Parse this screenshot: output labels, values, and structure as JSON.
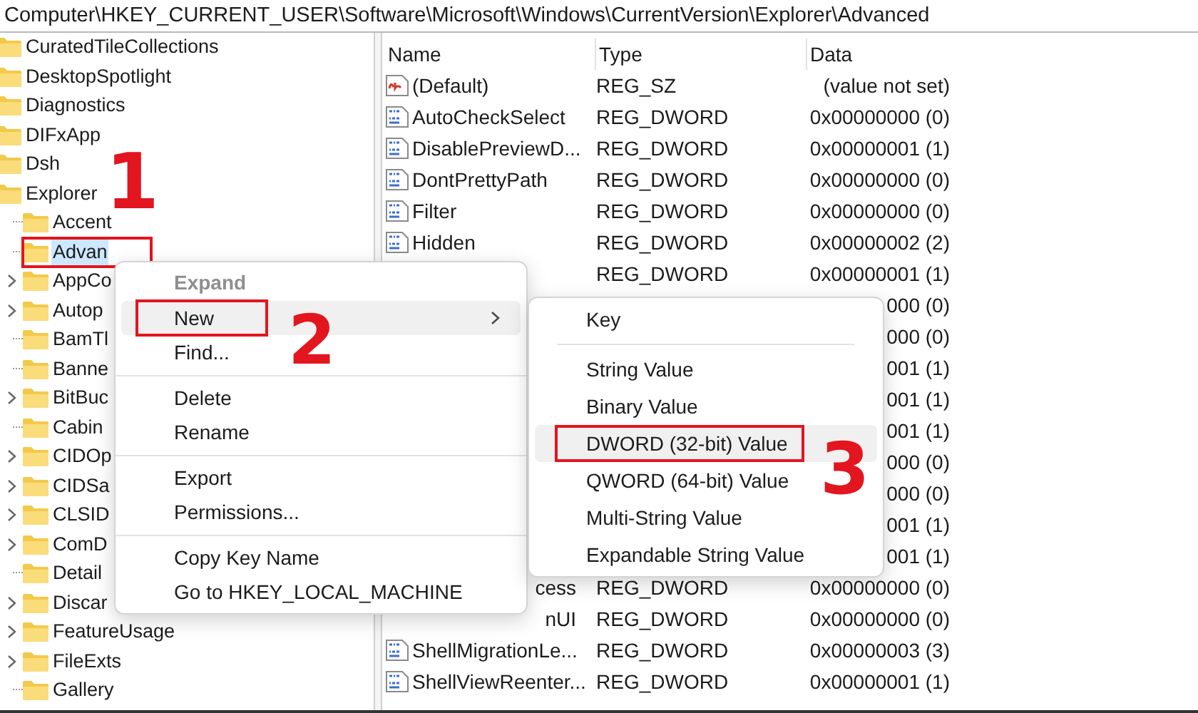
{
  "address_bar": "Computer\\HKEY_CURRENT_USER\\Software\\Microsoft\\Windows\\CurrentVersion\\Explorer\\Advanced",
  "tree": {
    "items": [
      {
        "label": "CuratedTileCollections",
        "selected": false
      },
      {
        "label": "DesktopSpotlight",
        "selected": false
      },
      {
        "label": "Diagnostics",
        "selected": false
      },
      {
        "label": "DIFxApp",
        "selected": false
      },
      {
        "label": "Dsh",
        "selected": false
      },
      {
        "label": "Explorer",
        "selected": false,
        "children": [
          {
            "label": "Accent",
            "expandable": false,
            "selected": false,
            "marked": false
          },
          {
            "label": "Advan",
            "expandable": false,
            "selected": true,
            "marked": true,
            "step": "1"
          },
          {
            "label": "AppCo",
            "expandable": true,
            "selected": false,
            "marked": false
          },
          {
            "label": "Autop",
            "expandable": true,
            "selected": false,
            "marked": false
          },
          {
            "label": "BamTl",
            "expandable": false,
            "selected": false,
            "marked": false
          },
          {
            "label": "Banne",
            "expandable": false,
            "selected": false,
            "marked": false
          },
          {
            "label": "BitBuc",
            "expandable": true,
            "selected": false,
            "marked": false
          },
          {
            "label": "Cabin",
            "expandable": false,
            "selected": false,
            "marked": false
          },
          {
            "label": "CIDOp",
            "expandable": true,
            "selected": false,
            "marked": false
          },
          {
            "label": "CIDSa",
            "expandable": true,
            "selected": false,
            "marked": false
          },
          {
            "label": "CLSID",
            "expandable": true,
            "selected": false,
            "marked": false
          },
          {
            "label": "ComD",
            "expandable": true,
            "selected": false,
            "marked": false
          },
          {
            "label": "Detail",
            "expandable": false,
            "selected": false,
            "marked": false
          },
          {
            "label": "Discar",
            "expandable": true,
            "selected": false,
            "marked": false
          },
          {
            "label": "FeatureUsage",
            "expandable": true,
            "selected": false,
            "marked": false
          },
          {
            "label": "FileExts",
            "expandable": true,
            "selected": false,
            "marked": false
          },
          {
            "label": "Gallery",
            "expandable": false,
            "selected": false,
            "marked": false
          }
        ]
      }
    ]
  },
  "values": {
    "columns": [
      "Name",
      "Type",
      "Data"
    ],
    "rows": [
      {
        "kind": "string",
        "name": "(Default)",
        "type": "REG_SZ",
        "data": "(value not set)"
      },
      {
        "kind": "dword",
        "name": "AutoCheckSelect",
        "type": "REG_DWORD",
        "data": "0x00000000 (0)"
      },
      {
        "kind": "dword",
        "name": "DisablePreviewD...",
        "type": "REG_DWORD",
        "data": "0x00000001 (1)"
      },
      {
        "kind": "dword",
        "name": "DontPrettyPath",
        "type": "REG_DWORD",
        "data": "0x00000000 (0)"
      },
      {
        "kind": "dword",
        "name": "Filter",
        "type": "REG_DWORD",
        "data": "0x00000000 (0)"
      },
      {
        "kind": "dword",
        "name": "Hidden",
        "type": "REG_DWORD",
        "data": "0x00000002 (2)"
      },
      {
        "kind": "partial",
        "type": "REG_DWORD",
        "data": "0x00000001 (1)"
      },
      {
        "kind": "partial",
        "data": "000 (0)"
      },
      {
        "kind": "partial",
        "data": "000 (0)"
      },
      {
        "kind": "partial",
        "data": "001 (1)"
      },
      {
        "kind": "partial",
        "data": "001 (1)"
      },
      {
        "kind": "partial",
        "data": "001 (1)"
      },
      {
        "kind": "partial",
        "data": "000 (0)"
      },
      {
        "kind": "partial",
        "data": "000 (0)"
      },
      {
        "kind": "partial",
        "data": "001 (1)"
      },
      {
        "kind": "partial",
        "data": "001 (1)"
      },
      {
        "kind": "partial",
        "name": "cess",
        "type": "REG_DWORD",
        "data": "0x00000000 (0)"
      },
      {
        "kind": "partial",
        "name": "nUI",
        "type": "REG_DWORD",
        "data": "0x00000000 (0)"
      },
      {
        "kind": "dword",
        "name": "ShellMigrationLe...",
        "type": "REG_DWORD",
        "data": "0x00000003 (3)"
      },
      {
        "kind": "dword",
        "name": "ShellViewReenter...",
        "type": "REG_DWORD",
        "data": "0x00000001 (1)"
      }
    ]
  },
  "context_menu": {
    "items": [
      {
        "kind": "item",
        "label": "Expand",
        "default": true,
        "disabled": true,
        "selected": false,
        "marked": false,
        "has_submenu": false
      },
      {
        "kind": "item",
        "label": "New",
        "default": false,
        "disabled": false,
        "selected": true,
        "marked": true,
        "has_submenu": true,
        "step": "2"
      },
      {
        "kind": "item",
        "label": "Find...",
        "default": false,
        "disabled": false,
        "selected": false,
        "marked": false,
        "has_submenu": false
      },
      {
        "kind": "separator"
      },
      {
        "kind": "item",
        "label": "Delete",
        "default": false,
        "disabled": false,
        "selected": false,
        "marked": false,
        "has_submenu": false
      },
      {
        "kind": "item",
        "label": "Rename",
        "default": false,
        "disabled": false,
        "selected": false,
        "marked": false,
        "has_submenu": false
      },
      {
        "kind": "separator"
      },
      {
        "kind": "item",
        "label": "Export",
        "default": false,
        "disabled": false,
        "selected": false,
        "marked": false,
        "has_submenu": false
      },
      {
        "kind": "item",
        "label": "Permissions...",
        "default": false,
        "disabled": false,
        "selected": false,
        "marked": false,
        "has_submenu": false
      },
      {
        "kind": "separator"
      },
      {
        "kind": "item",
        "label": "Copy Key Name",
        "default": false,
        "disabled": false,
        "selected": false,
        "marked": false,
        "has_submenu": false
      },
      {
        "kind": "item",
        "label": "Go to HKEY_LOCAL_MACHINE",
        "default": false,
        "disabled": false,
        "selected": false,
        "marked": false,
        "has_submenu": false
      }
    ]
  },
  "submenu": {
    "items": [
      {
        "kind": "item",
        "label": "Key",
        "selected": false,
        "marked": false
      },
      {
        "kind": "separator"
      },
      {
        "kind": "item",
        "label": "String Value",
        "selected": false,
        "marked": false
      },
      {
        "kind": "item",
        "label": "Binary Value",
        "selected": false,
        "marked": false
      },
      {
        "kind": "item",
        "label": "DWORD (32-bit) Value",
        "selected": true,
        "marked": true,
        "step": "3"
      },
      {
        "kind": "item",
        "label": "QWORD (64-bit) Value",
        "selected": false,
        "marked": false
      },
      {
        "kind": "item",
        "label": "Multi-String Value",
        "selected": false,
        "marked": false
      },
      {
        "kind": "item",
        "label": "Expandable String Value",
        "selected": false,
        "marked": false
      }
    ]
  }
}
